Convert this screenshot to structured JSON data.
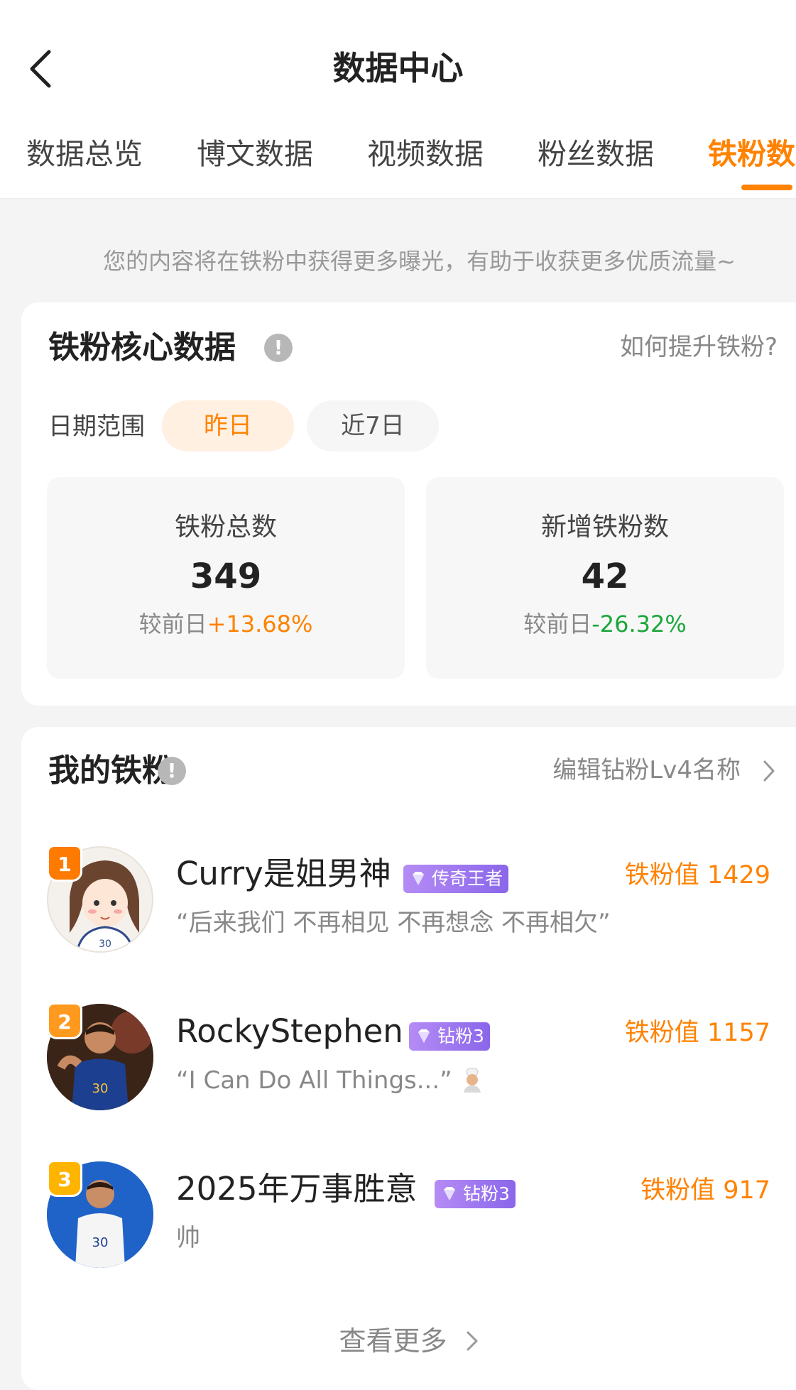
{
  "header": {
    "title": "数据中心"
  },
  "tabs": [
    {
      "label": "数据总览"
    },
    {
      "label": "博文数据"
    },
    {
      "label": "视频数据"
    },
    {
      "label": "粉丝数据"
    },
    {
      "label": "铁粉数"
    }
  ],
  "active_tab": "铁粉数",
  "notice": "您的内容将在铁粉中获得更多曝光，有助于收获更多优质流量~",
  "core": {
    "title": "铁粉核心数据",
    "help_link": "如何提升铁粉?",
    "date_label": "日期范围",
    "date_options": [
      "昨日",
      "近7日"
    ],
    "selected_date": "昨日",
    "stats": [
      {
        "label": "铁粉总数",
        "value": "349",
        "change_prefix": "较前日",
        "change": "+13.68%"
      },
      {
        "label": "新增铁粉数",
        "value": "42",
        "change_prefix": "较前日",
        "change": "-26.32%"
      }
    ]
  },
  "my_fans": {
    "title": "我的铁粉",
    "edit_link": "编辑钻粉Lv4名称",
    "items": [
      {
        "rank": "1",
        "name": "Curry是姐男神",
        "badge": "传奇王者",
        "value_label": "铁粉值 1429",
        "quote": "“后来我们 不再相见 不再想念 不再相欠”"
      },
      {
        "rank": "2",
        "name": "RockyStephen",
        "badge": "钻粉3",
        "value_label": "铁粉值 1157",
        "quote": "“I Can Do All Things...”"
      },
      {
        "rank": "3",
        "name": "2025年万事胜意",
        "badge": "钻粉3",
        "value_label": "铁粉值 917",
        "quote": "帅"
      }
    ],
    "more": "查看更多"
  },
  "colors": {
    "accent": "#ff8200",
    "up": "#ff8200",
    "down": "#1ba73b",
    "badge": "#9b74ee",
    "rank_badge": "#ff7a00"
  }
}
